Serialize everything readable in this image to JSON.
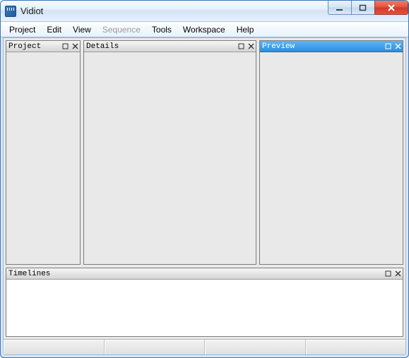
{
  "window": {
    "title": "Vidiot"
  },
  "menus": {
    "project": "Project",
    "edit": "Edit",
    "view": "View",
    "sequence": "Sequence",
    "tools": "Tools",
    "workspace": "Workspace",
    "help": "Help"
  },
  "panels": {
    "project_title": "Project",
    "details_title": "Details",
    "preview_title": "Preview",
    "timelines_title": "Timelines"
  }
}
